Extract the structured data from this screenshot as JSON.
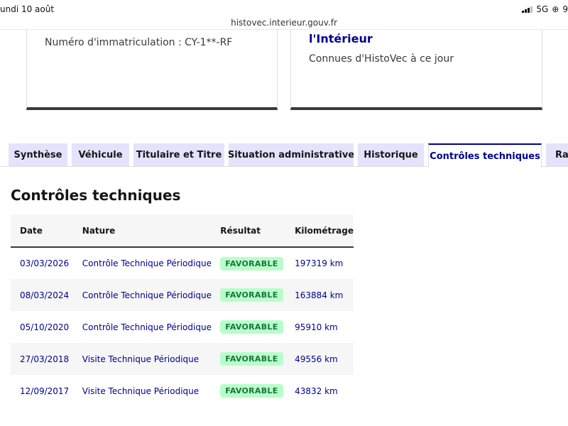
{
  "status_bar": {
    "date": "undi 10 août",
    "network": "5G",
    "battery": "9"
  },
  "browser": {
    "url": "histovec.interieur.gouv.fr"
  },
  "card_left": {
    "immatriculation": "Numéro d'immatriculation : CY-1**-RF"
  },
  "card_right": {
    "title": "l'Intérieur",
    "subtitle": "Connues d'HistoVec à ce jour"
  },
  "tabs": [
    {
      "label": "Synthèse"
    },
    {
      "label": "Véhicule"
    },
    {
      "label": "Titulaire et Titre"
    },
    {
      "label": "Situation administrative"
    },
    {
      "label": "Historique"
    },
    {
      "label": "Contrôles techniques",
      "active": true
    },
    {
      "label": "Ra"
    }
  ],
  "panel": {
    "title": "Contrôles techniques",
    "columns": [
      "Date",
      "Nature",
      "Résultat",
      "Kilométrage"
    ],
    "rows": [
      {
        "date": "03/03/2026",
        "nature": "Contrôle Technique Périodique",
        "result": "FAVORABLE",
        "km": "197319 km"
      },
      {
        "date": "08/03/2024",
        "nature": "Contrôle Technique Périodique",
        "result": "FAVORABLE",
        "km": "163884 km"
      },
      {
        "date": "05/10/2020",
        "nature": "Contrôle Technique Périodique",
        "result": "FAVORABLE",
        "km": "95910 km"
      },
      {
        "date": "27/03/2018",
        "nature": "Visite Technique Périodique",
        "result": "FAVORABLE",
        "km": "49556 km"
      },
      {
        "date": "12/09/2017",
        "nature": "Visite Technique Périodique",
        "result": "FAVORABLE",
        "km": "43832 km"
      }
    ]
  }
}
